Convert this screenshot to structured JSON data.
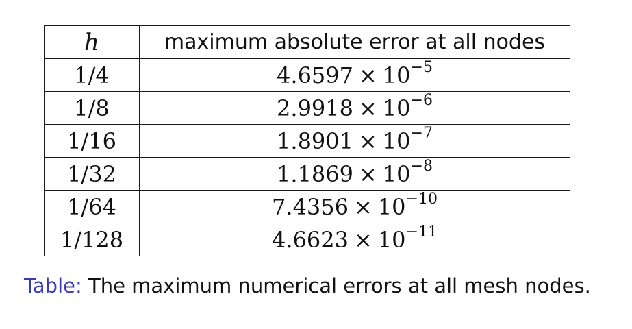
{
  "table": {
    "headers": {
      "h": "h",
      "error": "maximum absolute error at all nodes"
    },
    "times_symbol": "×",
    "rows": [
      {
        "h": "1/4",
        "mantissa": "4.6597",
        "base": "10",
        "exponent": "−5"
      },
      {
        "h": "1/8",
        "mantissa": "2.9918",
        "base": "10",
        "exponent": "−6"
      },
      {
        "h": "1/16",
        "mantissa": "1.8901",
        "base": "10",
        "exponent": "−7"
      },
      {
        "h": "1/32",
        "mantissa": "1.1869",
        "base": "10",
        "exponent": "−8"
      },
      {
        "h": "1/64",
        "mantissa": "7.4356",
        "base": "10",
        "exponent": "−10"
      },
      {
        "h": "1/128",
        "mantissa": "4.6623",
        "base": "10",
        "exponent": "−11"
      }
    ]
  },
  "caption": {
    "label": "Table:",
    "text": "The maximum numerical errors at all mesh nodes."
  },
  "colors": {
    "caption_label": "#3b3bb0",
    "text": "#111111",
    "border": "#1a1a1a"
  }
}
